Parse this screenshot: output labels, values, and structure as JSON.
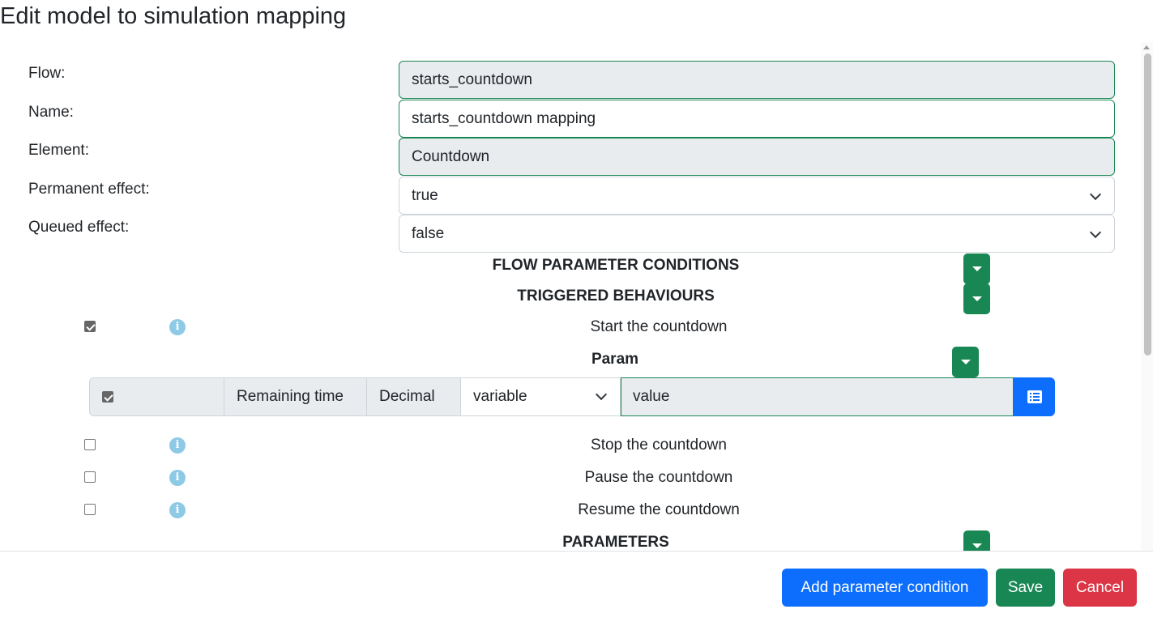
{
  "dialog": {
    "title": "Edit model to simulation mapping"
  },
  "form": {
    "flow": {
      "label": "Flow:",
      "value": "starts_countdown"
    },
    "name": {
      "label": "Name:",
      "value": "starts_countdown mapping"
    },
    "element": {
      "label": "Element:",
      "value": "Countdown"
    },
    "permanent_effect": {
      "label": "Permanent effect:",
      "value": "true"
    },
    "queued_effect": {
      "label": "Queued effect:",
      "value": "false"
    }
  },
  "sections": {
    "flow_parameter_conditions": "FLOW PARAMETER CONDITIONS",
    "triggered_behaviours": "TRIGGERED BEHAVIOURS",
    "param": "Param",
    "parameters": "PARAMETERS"
  },
  "behaviours": [
    {
      "label": "Start the countdown",
      "checked": true
    },
    {
      "label": "Stop the countdown",
      "checked": false
    },
    {
      "label": "Pause the countdown",
      "checked": false
    },
    {
      "label": "Resume the countdown",
      "checked": false
    }
  ],
  "param_row": {
    "checked": true,
    "name": "Remaining time",
    "type": "Decimal",
    "source": "variable",
    "value": "value"
  },
  "footer": {
    "add_condition": "Add parameter condition",
    "save": "Save",
    "cancel": "Cancel"
  },
  "colors": {
    "success": "#198754",
    "primary": "#0d6efd",
    "danger": "#dc3545",
    "info": "#8ecae6"
  },
  "icons": {
    "dropdown": "caret-down-icon",
    "info": "info-circle-icon",
    "list": "list-icon",
    "select": "chevron-down-icon"
  }
}
